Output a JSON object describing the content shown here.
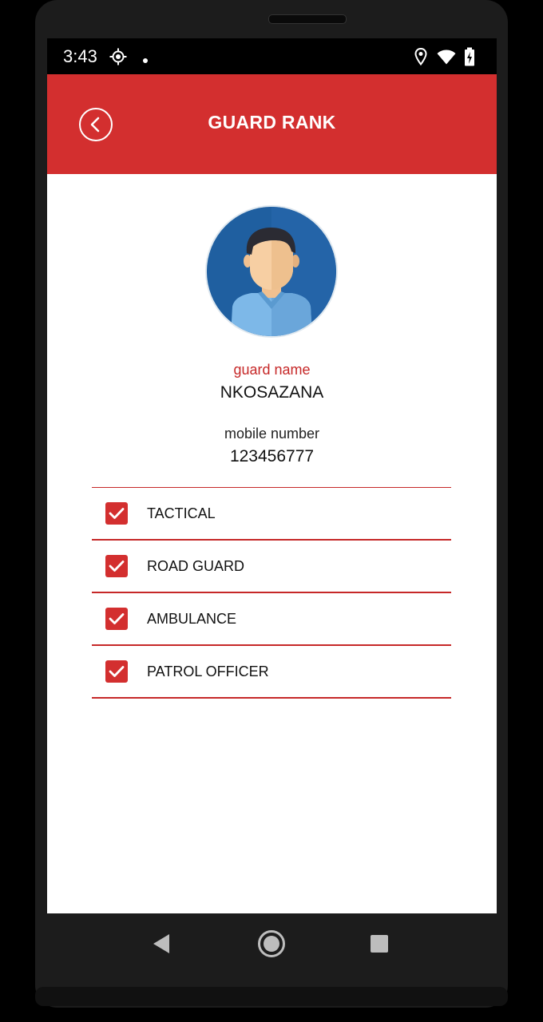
{
  "status_bar": {
    "time": "3:43",
    "icons": [
      "gps-icon",
      "dot-icon",
      "location-icon",
      "wifi-icon",
      "battery-charging-icon"
    ]
  },
  "app_bar": {
    "title": "GUARD RANK",
    "back_icon": "back-chevron-icon",
    "background_color": "#d32f2f"
  },
  "profile": {
    "avatar_icon": "guard-avatar-icon",
    "guard_name_label": "guard name",
    "guard_name": "NKOSAZANA",
    "mobile_label": "mobile number",
    "mobile_number": "123456777"
  },
  "ranks": [
    {
      "label": "TACTICAL",
      "checked": true
    },
    {
      "label": "ROAD GUARD",
      "checked": true
    },
    {
      "label": "AMBULANCE",
      "checked": true
    },
    {
      "label": "PATROL OFFICER",
      "checked": true
    }
  ],
  "nav_bar": {
    "icons": [
      "back-triangle-icon",
      "home-circle-icon",
      "recents-square-icon"
    ]
  },
  "colors": {
    "accent": "#d32f2f",
    "label_red": "#c62828"
  }
}
